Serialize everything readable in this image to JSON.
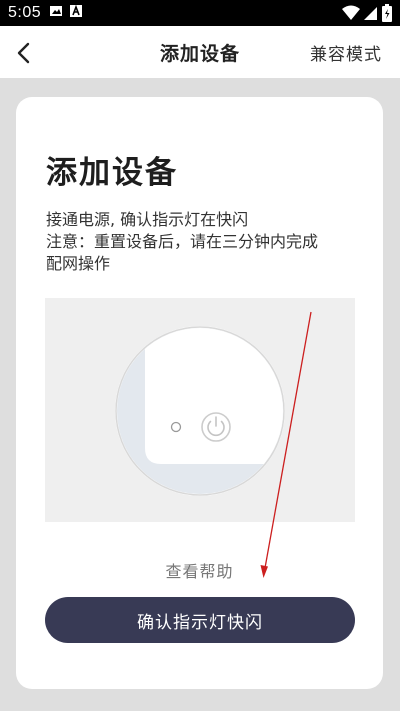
{
  "status_bar": {
    "time": "5:05",
    "icons": [
      "image-icon",
      "a-icon",
      "wifi-icon",
      "signal-icon",
      "battery-icon"
    ]
  },
  "nav": {
    "back_icon": "chevron-left-icon",
    "title": "添加设备",
    "compat_mode": "兼容模式"
  },
  "card": {
    "title": "添加设备",
    "desc_line1": "接通电源, 确认指示灯在快闪",
    "desc_line2": "注意：重置设备后，请在三分钟内完成",
    "desc_line3": "配网操作",
    "device_illustration_icon": "power-button-icon",
    "help_link": "查看帮助",
    "confirm_button": "确认指示灯快闪"
  },
  "colors": {
    "background": "#dedede",
    "card": "#ffffff",
    "button": "#383a55",
    "annotation_arrow": "#cc1f1f"
  }
}
